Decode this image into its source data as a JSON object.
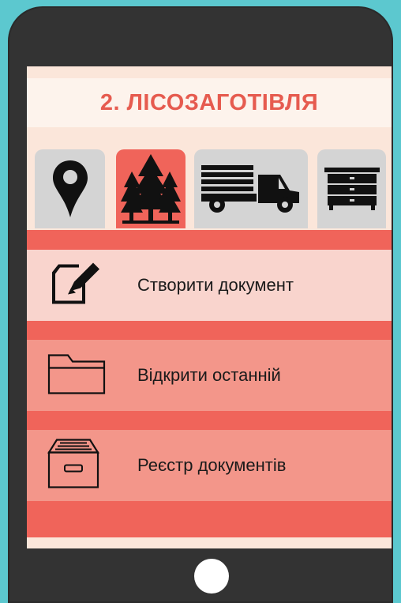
{
  "colors": {
    "background": "#5cc8cf",
    "phone_body": "#333333",
    "accent_red": "#f0645a",
    "title_red": "#e65b4f",
    "tab_inactive": "#d4d4d4",
    "item_light": "#f9d4cd",
    "item_medium": "#f3968a"
  },
  "header": {
    "title": "2. ЛІСОЗАГОТІВЛЯ"
  },
  "tabs": [
    {
      "icon": "map-pin-icon",
      "active": false
    },
    {
      "icon": "pine-trees-icon",
      "active": true
    },
    {
      "icon": "logging-truck-icon",
      "active": false
    },
    {
      "icon": "dresser-icon",
      "active": false
    }
  ],
  "menu": {
    "items": [
      {
        "label": "Створити документ",
        "icon": "edit-document-icon"
      },
      {
        "label": "Відкрити останній",
        "icon": "folder-icon"
      },
      {
        "label": "Реєстр документів",
        "icon": "archive-box-icon"
      }
    ]
  }
}
